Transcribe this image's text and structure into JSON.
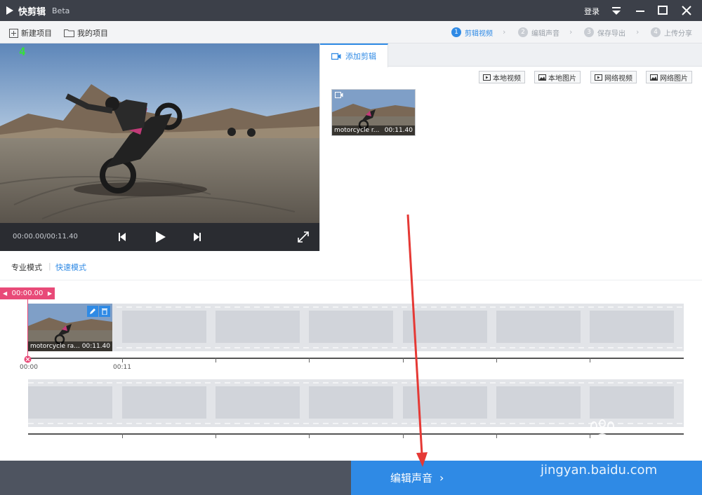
{
  "titlebar": {
    "app_name": "快剪辑",
    "beta": "Beta",
    "login": "登录"
  },
  "toolbar": {
    "new_project": "新建项目",
    "my_projects": "我的项目",
    "steps": [
      {
        "num": "1",
        "label": "剪辑视频",
        "active": true
      },
      {
        "num": "2",
        "label": "编辑声音",
        "active": false
      },
      {
        "num": "3",
        "label": "保存导出",
        "active": false
      },
      {
        "num": "4",
        "label": "上传分享",
        "active": false
      }
    ]
  },
  "player": {
    "overlay_number": "4",
    "time": "00:00.00/00:11.40"
  },
  "panel": {
    "tab_label": "添加剪辑",
    "sources": [
      "本地视频",
      "本地图片",
      "网络视频",
      "网络图片"
    ],
    "clip": {
      "name": "motorcycle r...",
      "duration": "00:11.40"
    }
  },
  "modes": {
    "pro": "专业模式",
    "quick": "快速模式"
  },
  "timeline": {
    "playhead": "00:00.00",
    "clip": {
      "name": "motorcycle ra...",
      "duration": "00:11.40"
    },
    "ticks": [
      "00:00",
      "00:11"
    ]
  },
  "footer": {
    "next_label": "编辑声音"
  },
  "watermark": {
    "line1": "Baidu经验",
    "line2": "jingyan.baidu.com"
  },
  "colors": {
    "accent": "#2f8ae5",
    "playhead": "#e84a78",
    "titlebar": "#3c4049",
    "annotation_arrow": "#e53935"
  }
}
